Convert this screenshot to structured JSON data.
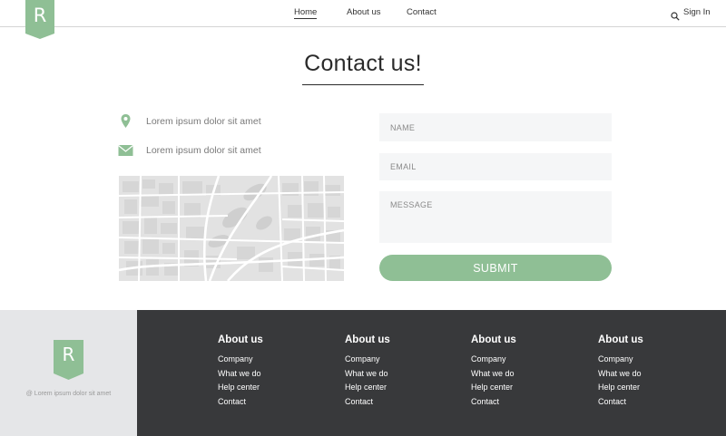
{
  "brand": {
    "letter": "R",
    "accent": "#8fbf95"
  },
  "nav": {
    "items": [
      "Home",
      "About us",
      "Contact"
    ],
    "active": "Home",
    "search_icon": "search-icon",
    "signin": "Sign In"
  },
  "page": {
    "title": "Contact us!"
  },
  "contact": {
    "address": {
      "icon": "location-pin-icon",
      "text": "Lorem ipsum dolor sit amet"
    },
    "email": {
      "icon": "envelope-icon",
      "text": "Lorem ipsum dolor sit amet"
    }
  },
  "form": {
    "name_placeholder": "NAME",
    "email_placeholder": "EMAIL",
    "message_placeholder": "MESSAGE",
    "submit_label": "SUBMIT"
  },
  "footer": {
    "tagline": "@ Lorem ipsum dolor sit amet",
    "columns": [
      {
        "title": "About us",
        "links": [
          "Company",
          "What we do",
          "Help center",
          "Contact"
        ]
      },
      {
        "title": "About us",
        "links": [
          "Company",
          "What we do",
          "Help center",
          "Contact"
        ]
      },
      {
        "title": "About us",
        "links": [
          "Company",
          "What we do",
          "Help center",
          "Contact"
        ]
      },
      {
        "title": "About us",
        "links": [
          "Company",
          "What we do",
          "Help center",
          "Contact"
        ]
      }
    ]
  }
}
